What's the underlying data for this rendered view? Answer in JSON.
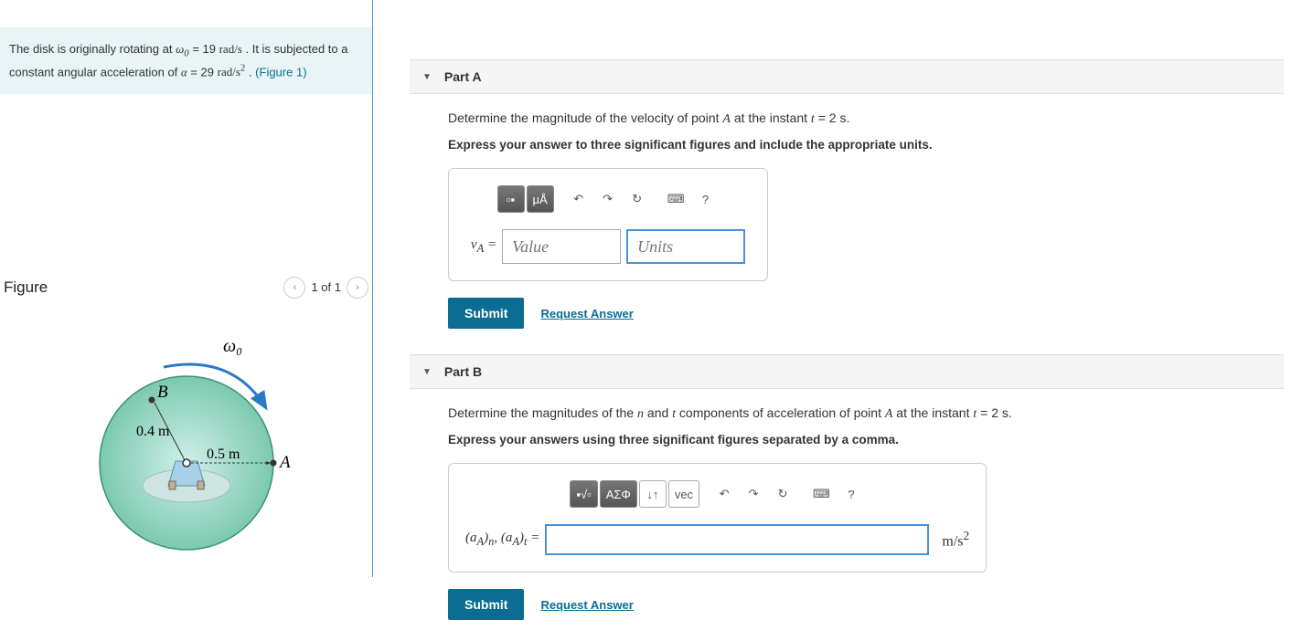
{
  "problem": {
    "text_1": "The disk is originally rotating at ",
    "omega_sym": "ω",
    "omega_sub": "0",
    "omega_eq": " = 19 ",
    "omega_unit": "rad/s",
    "text_2": " . It is subjected to a constant angular acceleration of ",
    "alpha_sym": "α",
    "alpha_eq": " = 29 ",
    "alpha_unit": "rad/s",
    "alpha_sup": "2",
    "text_3": " . ",
    "fig_link": "(Figure 1)"
  },
  "figure": {
    "title": "Figure",
    "counter": "1 of 1",
    "labels": {
      "omega0": "ω₀",
      "B": "B",
      "r_inner": "0.4 m",
      "r_outer": "0.5 m",
      "A": "A"
    }
  },
  "partA": {
    "title": "Part A",
    "q_1": "Determine the magnitude of the velocity of point ",
    "q_A": "A",
    "q_2": " at the instant ",
    "q_t": "t",
    "q_3": " = 2 s.",
    "instruction": "Express your answer to three significant figures and include the appropriate units.",
    "toolbar": {
      "btn1": "▫▪",
      "btn2": "μÅ",
      "undo": "↶",
      "redo": "↷",
      "reset": "↻",
      "keyboard": "⌨",
      "help": "?"
    },
    "label": "v",
    "label_sub": "A",
    "label_eq": " = ",
    "value_ph": "Value",
    "units_ph": "Units",
    "submit": "Submit",
    "request": "Request Answer"
  },
  "partB": {
    "title": "Part B",
    "q_1": "Determine the magnitudes of the ",
    "q_n": "n",
    "q_2": " and ",
    "q_t": "t",
    "q_3": " components of acceleration of point ",
    "q_A": "A",
    "q_4": " at the instant ",
    "q_tv": "t",
    "q_5": " = 2 s.",
    "instruction": "Express your answers using three significant figures separated by a comma.",
    "toolbar": {
      "btn1": "▪√▫",
      "btn2": "ΑΣΦ",
      "btn3": "↓↑",
      "btn4": "vec",
      "undo": "↶",
      "redo": "↷",
      "reset": "↻",
      "keyboard": "⌨",
      "help": "?"
    },
    "label_pre": "(a",
    "label_sub1": "A",
    "label_1": ")",
    "label_sub2": "n",
    "label_sep": ", (a",
    "label_sub3": "A",
    "label_2": ")",
    "label_sub4": "t",
    "label_eq": " = ",
    "unit": "m/s",
    "unit_sup": "2",
    "submit": "Submit",
    "request": "Request Answer"
  }
}
